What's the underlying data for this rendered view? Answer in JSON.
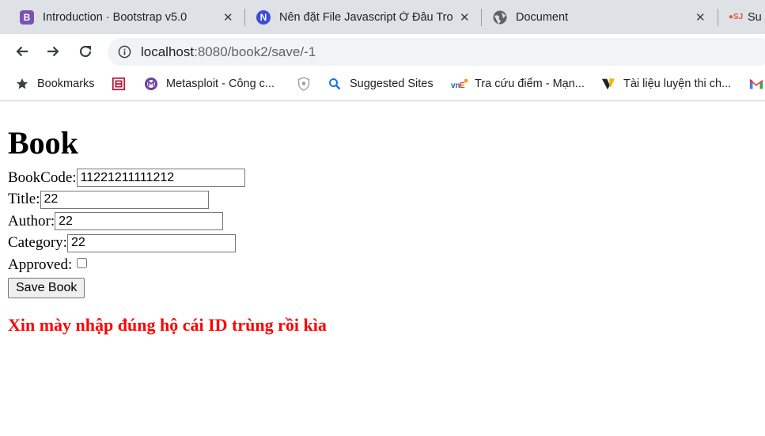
{
  "browser": {
    "tabs": [
      {
        "title": "Introduction · Bootstrap v5.0",
        "favicon": "bootstrap-icon",
        "favicon_color": "#7952b3"
      },
      {
        "title": "Nên đặt File Javascript Ở Đâu Tro",
        "favicon": "n-icon",
        "favicon_color": "#3f4ad6"
      },
      {
        "title": "Document",
        "favicon": "globe-icon",
        "favicon_color": "#5f6368"
      },
      {
        "title": "Su",
        "favicon": "sj-icon",
        "favicon_color": "#e05a3a"
      }
    ],
    "tab_close_glyph": "✕",
    "address": {
      "host": "localhost",
      "path": ":8080/book2/save/-1"
    },
    "bookmarks": [
      {
        "label": "Bookmarks",
        "icon": "star-icon"
      },
      {
        "label": "",
        "icon": "book-icon"
      },
      {
        "label": "Metasploit - Công c...",
        "icon": "metasploit-icon"
      },
      {
        "label": "",
        "icon": "shield-icon"
      },
      {
        "label": "Suggested Sites",
        "icon": "search-icon"
      },
      {
        "label": "Tra cứu điểm - Mạn...",
        "icon": "vnedu-icon"
      },
      {
        "label": "Tài liệu luyện thi ch...",
        "icon": "vietjack-icon"
      },
      {
        "label": "",
        "icon": "gmail-icon"
      }
    ]
  },
  "page": {
    "heading": "Book",
    "fields": {
      "bookcode": {
        "label": "BookCode:",
        "value": "11221211111212"
      },
      "title": {
        "label": "Title:",
        "value": "22"
      },
      "author": {
        "label": "Author:",
        "value": "22"
      },
      "category": {
        "label": "Category:",
        "value": "22"
      }
    },
    "approved_label": "Approved:",
    "approved": false,
    "save_label": "Save Book",
    "error_message": "Xin mày nhập đúng hộ cái ID trùng rồi kìa",
    "error_color": "#ff0000"
  }
}
